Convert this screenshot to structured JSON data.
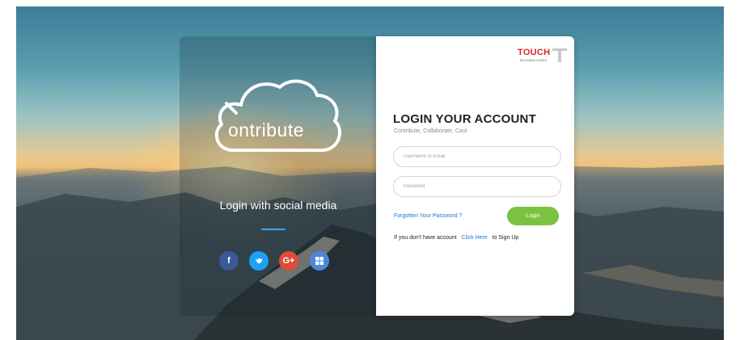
{
  "left_panel": {
    "logo_text": "ontribute",
    "social_title": "Login with social media",
    "social_buttons": [
      {
        "label": "f",
        "icon": "facebook-icon",
        "color": "#3b5998"
      },
      {
        "label": "",
        "icon": "twitter-icon",
        "color": "#1da1f2"
      },
      {
        "label": "G+",
        "icon": "google-plus-icon",
        "color": "#dd4b39"
      },
      {
        "label": "",
        "icon": "windows-icon",
        "color": "#4a88e0"
      }
    ]
  },
  "brand": {
    "name": "TOUCH",
    "suffix": "T",
    "tagline": "TECHNOLOGIES"
  },
  "form": {
    "heading": "LOGIN YOUR ACCOUNT",
    "subheading": "Contribute, Collaborate, Cast",
    "username_placeholder": "Username or Email",
    "password_placeholder": "Password",
    "forgot_label": "Forgotten Your Password ?",
    "login_label": "Login",
    "signup_prefix": "If you don't have account",
    "signup_link": "Click Here",
    "signup_suffix": "to Sign Up"
  },
  "colors": {
    "login_button": "#7cc242",
    "link": "#1f74d6",
    "brand_red": "#d9262b"
  }
}
